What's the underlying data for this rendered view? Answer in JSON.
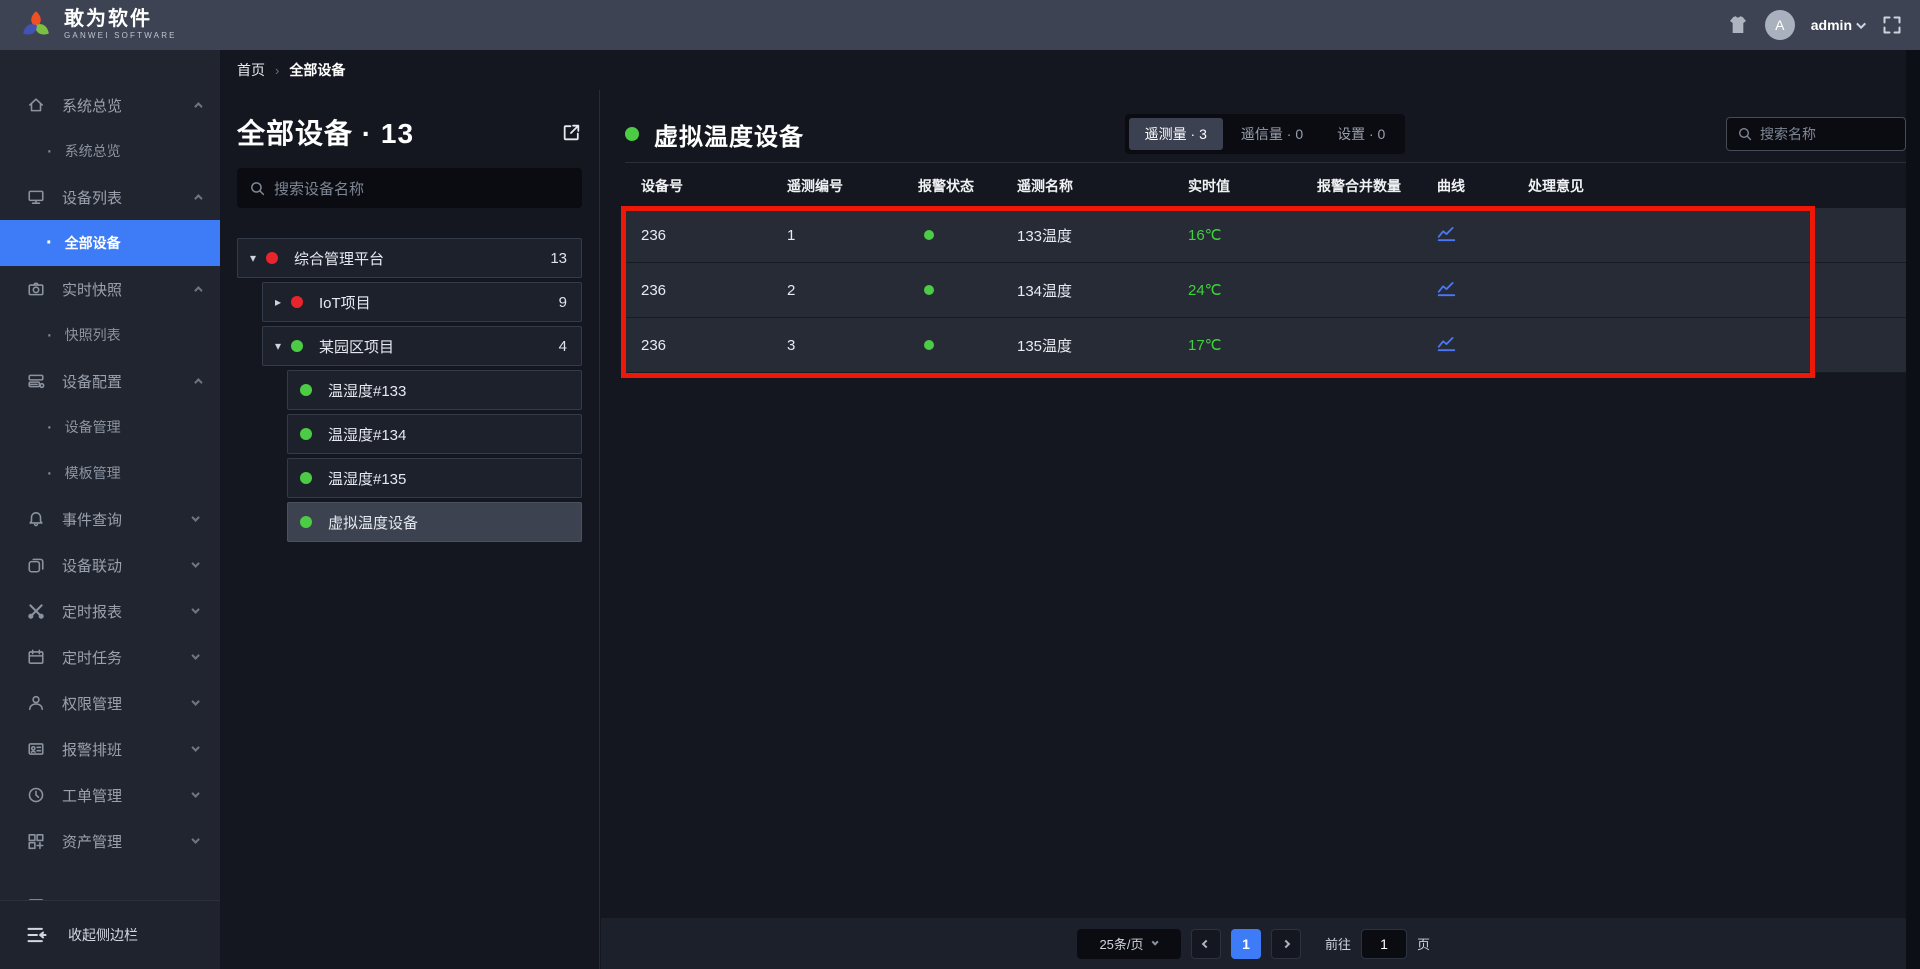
{
  "header": {
    "brand_cn": "敢为软件",
    "brand_en": "GANWEI SOFTWARE",
    "avatar_letter": "A",
    "user_name": "admin"
  },
  "breadcrumb": {
    "home": "首页",
    "separator": "›",
    "current": "全部设备"
  },
  "sidebar": {
    "groups": [
      {
        "label": "系统总览",
        "icon": "home-icon",
        "state": "expanded",
        "children": [
          "系统总览"
        ]
      },
      {
        "label": "设备列表",
        "icon": "monitor-icon",
        "state": "expanded",
        "children": [
          "全部设备"
        ],
        "active_child": "全部设备"
      },
      {
        "label": "实时快照",
        "icon": "camera-icon",
        "state": "expanded",
        "children": [
          "快照列表"
        ]
      },
      {
        "label": "设备配置",
        "icon": "server-icon",
        "state": "expanded",
        "children": [
          "设备管理",
          "模板管理"
        ]
      },
      {
        "label": "事件查询",
        "icon": "event-bell-icon",
        "state": "collapsed"
      },
      {
        "label": "设备联动",
        "icon": "linkage-icon",
        "state": "collapsed"
      },
      {
        "label": "定时报表",
        "icon": "report-icon",
        "state": "collapsed"
      },
      {
        "label": "定时任务",
        "icon": "calendar-icon",
        "state": "collapsed"
      },
      {
        "label": "权限管理",
        "icon": "user-icon",
        "state": "collapsed"
      },
      {
        "label": "报警排班",
        "icon": "idcard-icon",
        "state": "collapsed"
      },
      {
        "label": "工单管理",
        "icon": "clock-icon",
        "state": "collapsed"
      },
      {
        "label": "资产管理",
        "icon": "asset-icon",
        "state": "collapsed"
      }
    ],
    "collapse_label": "收起侧边栏"
  },
  "device_panel": {
    "title": "全部设备 · 13",
    "search_placeholder": "搜索设备名称",
    "tree": [
      {
        "label": "综合管理平台",
        "count": "13",
        "status": "red",
        "level": 0,
        "caret": "▾"
      },
      {
        "label": "IoT项目",
        "count": "9",
        "status": "red",
        "level": 1,
        "caret": "▸"
      },
      {
        "label": "某园区项目",
        "count": "4",
        "status": "green",
        "level": 1,
        "caret": "▾"
      },
      {
        "label": "温湿度#133",
        "count": "",
        "status": "green",
        "level": 2,
        "caret": ""
      },
      {
        "label": "温湿度#134",
        "count": "",
        "status": "green",
        "level": 2,
        "caret": ""
      },
      {
        "label": "温湿度#135",
        "count": "",
        "status": "green",
        "level": 2,
        "caret": ""
      },
      {
        "label": "虚拟温度设备",
        "count": "",
        "status": "green",
        "level": 2,
        "caret": "",
        "selected": true
      }
    ]
  },
  "main": {
    "title": "虚拟温度设备",
    "status": "green",
    "tabs": [
      {
        "label": "遥测量 · 3",
        "active": true
      },
      {
        "label": "遥信量 · 0",
        "active": false
      },
      {
        "label": "设置 · 0",
        "active": false
      }
    ],
    "search_placeholder": "搜索名称",
    "table": {
      "columns": [
        "设备号",
        "遥测编号",
        "报警状态",
        "遥测名称",
        "实时值",
        "报警合并数量",
        "曲线",
        "处理意见"
      ],
      "rows": [
        {
          "device_id": "236",
          "telemetry_no": "1",
          "alarm_status": "green",
          "telemetry_name": "133温度",
          "realtime_value": "16℃",
          "merge_count": "",
          "comment": ""
        },
        {
          "device_id": "236",
          "telemetry_no": "2",
          "alarm_status": "green",
          "telemetry_name": "134温度",
          "realtime_value": "24℃",
          "merge_count": "",
          "comment": ""
        },
        {
          "device_id": "236",
          "telemetry_no": "3",
          "alarm_status": "green",
          "telemetry_name": "135温度",
          "realtime_value": "17℃",
          "merge_count": "",
          "comment": ""
        }
      ]
    },
    "pagination": {
      "page_size": "25条/页",
      "current_page": "1",
      "goto_label": "前往",
      "goto_value": "1",
      "unit_label": "页"
    }
  },
  "colors": {
    "accent_blue": "#3e7bf7",
    "status_green": "#4ccc44",
    "status_red": "#e8252c",
    "value_green": "#3ed33b",
    "annotation_red": "#ee1808",
    "curve_icon_blue": "#4a78f5"
  }
}
